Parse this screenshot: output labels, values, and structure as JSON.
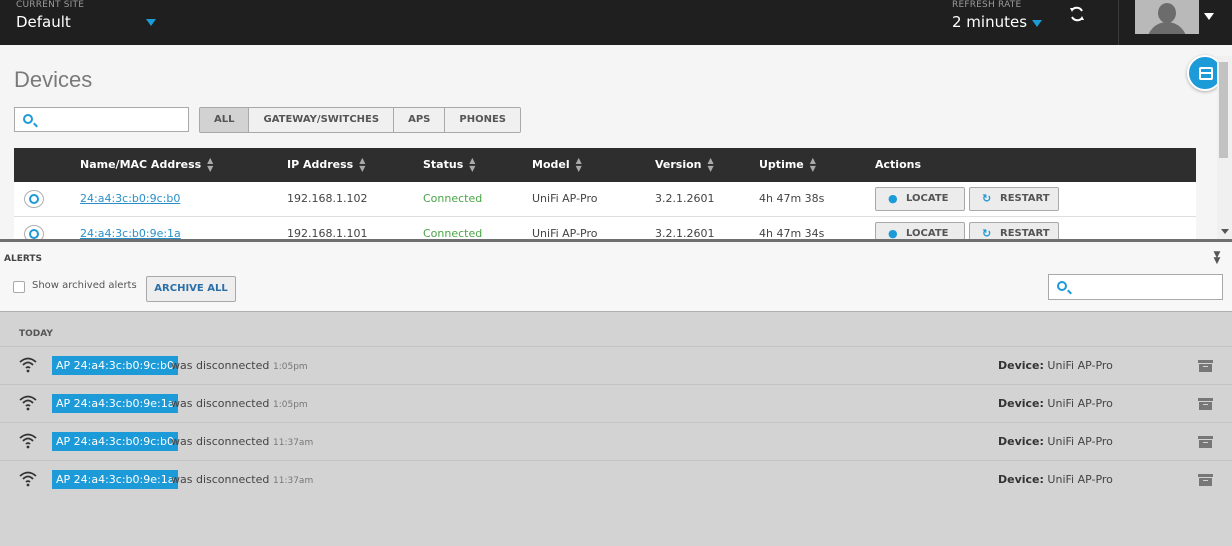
{
  "topbar": {
    "site_label": "CURRENT SITE",
    "site_value": "Default",
    "refresh_label": "REFRESH RATE",
    "refresh_value": "2 minutes",
    "refresh_icon": "refresh-icon",
    "avatar_icon": "user-avatar"
  },
  "devices": {
    "title": "Devices",
    "search_placeholder": "",
    "filters": [
      "ALL",
      "GATEWAY/SWITCHES",
      "APS",
      "PHONES"
    ],
    "active_filter": "ALL",
    "columns": [
      "Name/MAC Address",
      "IP Address",
      "Status",
      "Model",
      "Version",
      "Uptime",
      "Actions"
    ],
    "rows": [
      {
        "name": "24:a4:3c:b0:9c:b0",
        "ip": "192.168.1.102",
        "status": "Connected",
        "model": "UniFi AP-Pro",
        "version": "3.2.1.2601",
        "uptime": "4h 47m 38s"
      },
      {
        "name": "24:a4:3c:b0:9e:1a",
        "ip": "192.168.1.101",
        "status": "Connected",
        "model": "UniFi AP-Pro",
        "version": "3.2.1.2601",
        "uptime": "4h 47m 34s"
      }
    ],
    "locate_label": "LOCATE",
    "restart_label": "RESTART"
  },
  "alerts": {
    "title": "ALERTS",
    "show_archived_label": "Show archived alerts",
    "archive_all_label": "ARCHIVE ALL",
    "group_label": "TODAY",
    "device_label": "Device:",
    "items": [
      {
        "badge": "AP 24:a4:3c:b0:9c:b0",
        "message": "was disconnected",
        "time": "1:05pm",
        "device": "UniFi AP-Pro"
      },
      {
        "badge": "AP 24:a4:3c:b0:9e:1a",
        "message": "was disconnected",
        "time": "1:05pm",
        "device": "UniFi AP-Pro"
      },
      {
        "badge": "AP 24:a4:3c:b0:9c:b0",
        "message": "was disconnected",
        "time": "11:37am",
        "device": "UniFi AP-Pro"
      },
      {
        "badge": "AP 24:a4:3c:b0:9e:1a",
        "message": "was disconnected",
        "time": "11:37am",
        "device": "UniFi AP-Pro"
      }
    ]
  },
  "colors": {
    "accent": "#1d9ad8",
    "connected": "#4aa547",
    "topbar": "#1f1f1f"
  }
}
